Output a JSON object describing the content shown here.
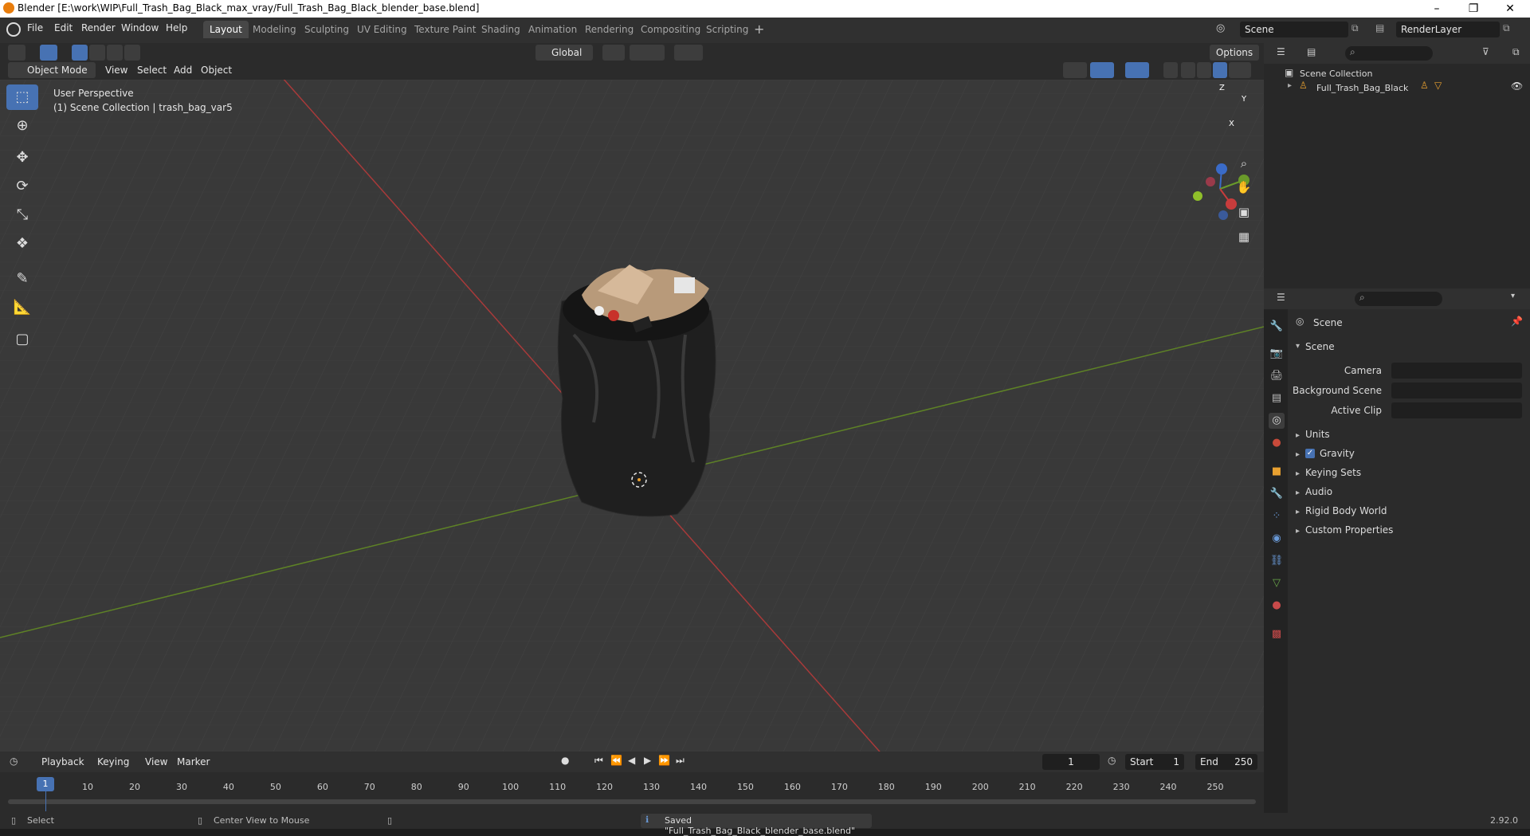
{
  "window": {
    "title": "Blender [E:\\work\\WIP\\Full_Trash_Bag_Black_max_vray/Full_Trash_Bag_Black_blender_base.blend]"
  },
  "menu": [
    "File",
    "Edit",
    "Render",
    "Window",
    "Help"
  ],
  "workspaces": [
    "Layout",
    "Modeling",
    "Sculpting",
    "UV Editing",
    "Texture Paint",
    "Shading",
    "Animation",
    "Rendering",
    "Compositing",
    "Scripting"
  ],
  "topright": {
    "scene": "Scene",
    "view_layer": "RenderLayer"
  },
  "viewport_header": {
    "mode": "Object Mode",
    "menus": [
      "View",
      "Select",
      "Add",
      "Object"
    ],
    "orientation": "Global",
    "options": "Options"
  },
  "viewport": {
    "perspective": "User Perspective",
    "collection_info": "(1) Scene Collection | trash_bag_var5",
    "gizmo_axes": [
      "Z",
      "Y",
      "X"
    ]
  },
  "outliner": {
    "root": "Scene Collection",
    "items": [
      "Full_Trash_Bag_Black"
    ]
  },
  "properties": {
    "header": "Scene",
    "panel": "Scene",
    "fields": [
      {
        "label": "Camera",
        "value": ""
      },
      {
        "label": "Background Scene",
        "value": ""
      },
      {
        "label": "Active Clip",
        "value": ""
      }
    ],
    "sections": [
      "Units",
      "Gravity",
      "Keying Sets",
      "Audio",
      "Rigid Body World",
      "Custom Properties"
    ],
    "gravity_checked": true
  },
  "timeline": {
    "menus": [
      "Playback",
      "Keying",
      "View",
      "Marker"
    ],
    "current_frame": "1",
    "start_label": "Start",
    "start": "1",
    "end_label": "End",
    "end": "250",
    "ticks": [
      "1",
      "10",
      "20",
      "30",
      "40",
      "50",
      "60",
      "70",
      "80",
      "90",
      "100",
      "110",
      "120",
      "130",
      "140",
      "150",
      "160",
      "170",
      "180",
      "190",
      "200",
      "210",
      "220",
      "230",
      "240",
      "250"
    ]
  },
  "status": {
    "left": "Select",
    "middle": "Center View to Mouse",
    "message": "Saved \"Full_Trash_Bag_Black_blender_base.blend\"",
    "version": "2.92.0"
  },
  "colors": {
    "accent": "#4772b3",
    "x_axis": "#c83c3c",
    "y_axis": "#6a9a2a",
    "viewport_bg": "#393939"
  }
}
